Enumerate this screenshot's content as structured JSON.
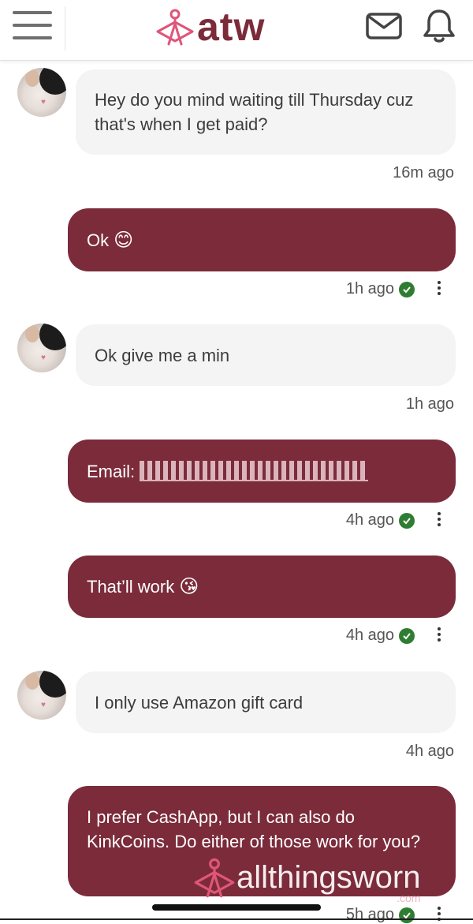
{
  "header": {
    "logo_text": "atw",
    "menu_icon": "hamburger-icon",
    "mail_icon": "envelope-icon",
    "bell_icon": "bell-icon"
  },
  "colors": {
    "brand": "#7b2b3a",
    "logo_accent": "#e0557a",
    "incoming_bubble": "#f4f4f5",
    "read_check": "#2f7d32"
  },
  "messages": [
    {
      "direction": "in",
      "text": "Hey do you mind waiting till Thursday cuz that's when I get paid?",
      "time": "16m ago"
    },
    {
      "direction": "out",
      "text": "Ok",
      "emoji": "😊",
      "time": "1h ago"
    },
    {
      "direction": "in",
      "text": "Ok give me a min",
      "time": "1h ago"
    },
    {
      "direction": "out",
      "label": "Email:",
      "time": "4h ago"
    },
    {
      "direction": "out",
      "text": "That’ll work",
      "emoji": "😘",
      "time": "4h ago"
    },
    {
      "direction": "in",
      "text": "I only use Amazon gift card",
      "time": "4h ago"
    },
    {
      "direction": "out",
      "text": "I prefer CashApp, but I can also do KinkCoins. Do either of those work for you?",
      "time": "5h ago"
    }
  ],
  "watermark": {
    "text": "allthingsworn",
    "sub": ".com"
  }
}
